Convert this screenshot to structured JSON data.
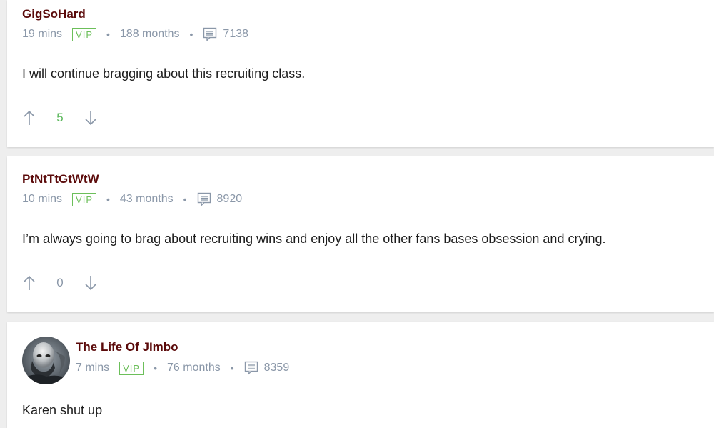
{
  "comments": [
    {
      "username": "GigSoHard",
      "time": "19 mins",
      "badge": "VIP",
      "tenure": "188 months",
      "post_count": "7138",
      "body": "I will continue bragging about this recruiting class.",
      "score": "5",
      "score_color": "#5cb85c"
    },
    {
      "username": "PtNtTtGtWtW",
      "time": "10 mins",
      "badge": "VIP",
      "tenure": "43 months",
      "post_count": "8920",
      "body": "I’m always going to brag about recruiting wins and enjoy all the other fans bases obsession and crying.",
      "score": "0",
      "score_color": "#8a97a8"
    },
    {
      "username": "The Life Of JImbo",
      "time": "7 mins",
      "badge": "VIP",
      "tenure": "76 months",
      "post_count": "8359",
      "body": "Karen shut up"
    }
  ],
  "separator": "•",
  "icons": {
    "post_count": "comment-bubble-icon",
    "upvote": "arrow-up-icon",
    "downvote": "arrow-down-icon"
  },
  "colors": {
    "username": "#5b0a0a",
    "vip": "#6cbf5a",
    "meta": "#8a97a8"
  }
}
